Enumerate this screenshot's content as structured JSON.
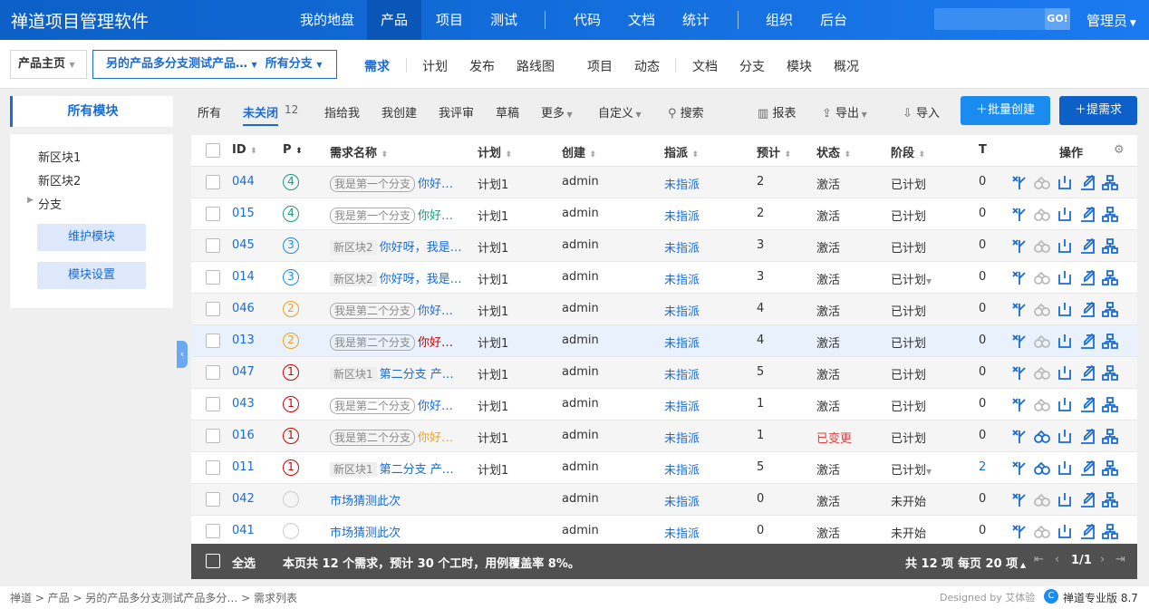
{
  "app": {
    "title": "禅道项目管理软件"
  },
  "topnav": {
    "items": [
      "我的地盘",
      "产品",
      "项目",
      "测试",
      "代码",
      "文档",
      "统计",
      "组织",
      "后台"
    ],
    "go": "GO!",
    "user": "管理员"
  },
  "breadcrumb": {
    "home": "产品主页",
    "product": "另的产品多分支测试产品…",
    "branch": "所有分支"
  },
  "subnav": [
    "需求",
    "计划",
    "发布",
    "路线图",
    "项目",
    "动态",
    "文档",
    "分支",
    "模块",
    "概况"
  ],
  "sidebar": {
    "title": "所有模块",
    "tree": [
      "新区块1",
      "新区块2",
      "分支"
    ],
    "buttons": [
      "维护模块",
      "模块设置"
    ]
  },
  "filters": {
    "tabs": [
      "所有",
      "未关闭",
      "指给我",
      "我创建",
      "我评审",
      "草稿",
      "更多",
      "自定义"
    ],
    "count": "12",
    "search": "搜索"
  },
  "tools": {
    "report": "报表",
    "export": "导出",
    "import": "导入",
    "batch_create": "批量创建",
    "create": "提需求"
  },
  "columns": [
    "ID",
    "P",
    "需求名称",
    "计划",
    "创建",
    "指派",
    "预计",
    "状态",
    "阶段",
    "T",
    "操作"
  ],
  "rows": [
    {
      "id": "044",
      "p": "4",
      "tag": "我是第一个分支",
      "name": "你好…",
      "plan": "计划1",
      "creator": "admin",
      "assign": "未指派",
      "est": "2",
      "status": "激活",
      "stage": "已计划",
      "t": "0"
    },
    {
      "id": "015",
      "p": "4",
      "tag": "我是第一个分支",
      "name": "你好…",
      "plan": "计划1",
      "creator": "admin",
      "assign": "未指派",
      "est": "2",
      "status": "激活",
      "stage": "已计划",
      "t": "0"
    },
    {
      "id": "045",
      "p": "3",
      "tag": "新区块2",
      "name": "你好呀，我是…",
      "plan": "计划1",
      "creator": "admin",
      "assign": "未指派",
      "est": "3",
      "status": "激活",
      "stage": "已计划",
      "t": "0"
    },
    {
      "id": "014",
      "p": "3",
      "tag": "新区块2",
      "name": "你好呀，我是…",
      "plan": "计划1",
      "creator": "admin",
      "assign": "未指派",
      "est": "3",
      "status": "激活",
      "stage": "已计划",
      "t": "0"
    },
    {
      "id": "046",
      "p": "2",
      "tag": "我是第二个分支",
      "name": "你好…",
      "plan": "计划1",
      "creator": "admin",
      "assign": "未指派",
      "est": "4",
      "status": "激活",
      "stage": "已计划",
      "t": "0"
    },
    {
      "id": "013",
      "p": "2",
      "tag": "我是第二个分支",
      "name": "你好…",
      "plan": "计划1",
      "creator": "admin",
      "assign": "未指派",
      "est": "4",
      "status": "激活",
      "stage": "已计划",
      "t": "0"
    },
    {
      "id": "047",
      "p": "1",
      "tag": "新区块1",
      "name": "第二分支 产…",
      "plan": "计划1",
      "creator": "admin",
      "assign": "未指派",
      "est": "5",
      "status": "激活",
      "stage": "已计划",
      "t": "0"
    },
    {
      "id": "043",
      "p": "1",
      "tag": "我是第二个分支",
      "name": "你好…",
      "plan": "计划1",
      "creator": "admin",
      "assign": "未指派",
      "est": "1",
      "status": "激活",
      "stage": "已计划",
      "t": "0"
    },
    {
      "id": "016",
      "p": "1",
      "tag": "我是第二个分支",
      "name": "你好…",
      "plan": "计划1",
      "creator": "admin",
      "assign": "未指派",
      "est": "1",
      "status": "已变更",
      "stage": "已计划",
      "t": "0"
    },
    {
      "id": "011",
      "p": "1",
      "tag": "新区块1",
      "name": "第二分支 产…",
      "plan": "计划1",
      "creator": "admin",
      "assign": "未指派",
      "est": "5",
      "status": "激活",
      "stage": "已计划",
      "t": "2"
    },
    {
      "id": "042",
      "p": "",
      "tag": "",
      "name": "市场猜测此次",
      "plan": "",
      "creator": "admin",
      "assign": "未指派",
      "est": "0",
      "status": "激活",
      "stage": "未开始",
      "t": "0"
    },
    {
      "id": "041",
      "p": "",
      "tag": "",
      "name": "市场猜测此次",
      "plan": "",
      "creator": "admin",
      "assign": "未指派",
      "est": "0",
      "status": "激活",
      "stage": "未开始",
      "t": "0"
    }
  ],
  "footer": {
    "select_all": "全选",
    "summary": "本页共 12 个需求，预计 30 个工时，用例覆盖率 8%。",
    "total": "共 12 项",
    "per_page": "每页 20 项",
    "page": "1/1"
  },
  "pathbar": {
    "path": "禅道 > 产品 > 另的产品多分支测试产品多分… > 需求列表",
    "designed": "Designed by 艾体验",
    "version": "禅道专业版 8.7"
  },
  "colors": {
    "primary": "#1a6bd5",
    "p1": "#c00",
    "p2": "#f0a020",
    "p3": "#1a8cf0",
    "p4": "#1a9a7a",
    "changed": "#e04040"
  }
}
